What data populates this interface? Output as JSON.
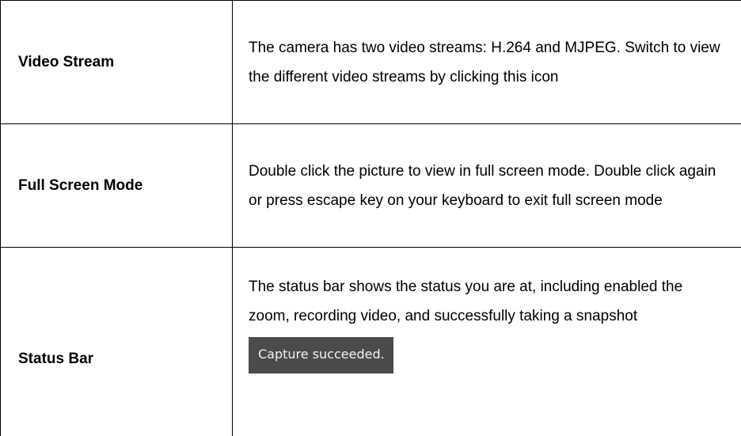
{
  "rows": [
    {
      "term": "Video Stream",
      "description": "The camera has two video streams: H.264 and MJPEG. Switch to view the different video streams by clicking this icon"
    },
    {
      "term": "Full Screen Mode",
      "description": "Double click the picture to view in full screen mode. Double click again or press escape key on your keyboard to exit full screen mode"
    },
    {
      "term": "Status Bar",
      "description": "The status bar shows the status you are at, including enabled the zoom, recording video, and successfully taking a snapshot",
      "status_sample": "Capture succeeded."
    }
  ],
  "colors": {
    "border": "#000000",
    "status_bar_bg": "#4b4b4b",
    "status_bar_text": "#f2f2f2"
  }
}
